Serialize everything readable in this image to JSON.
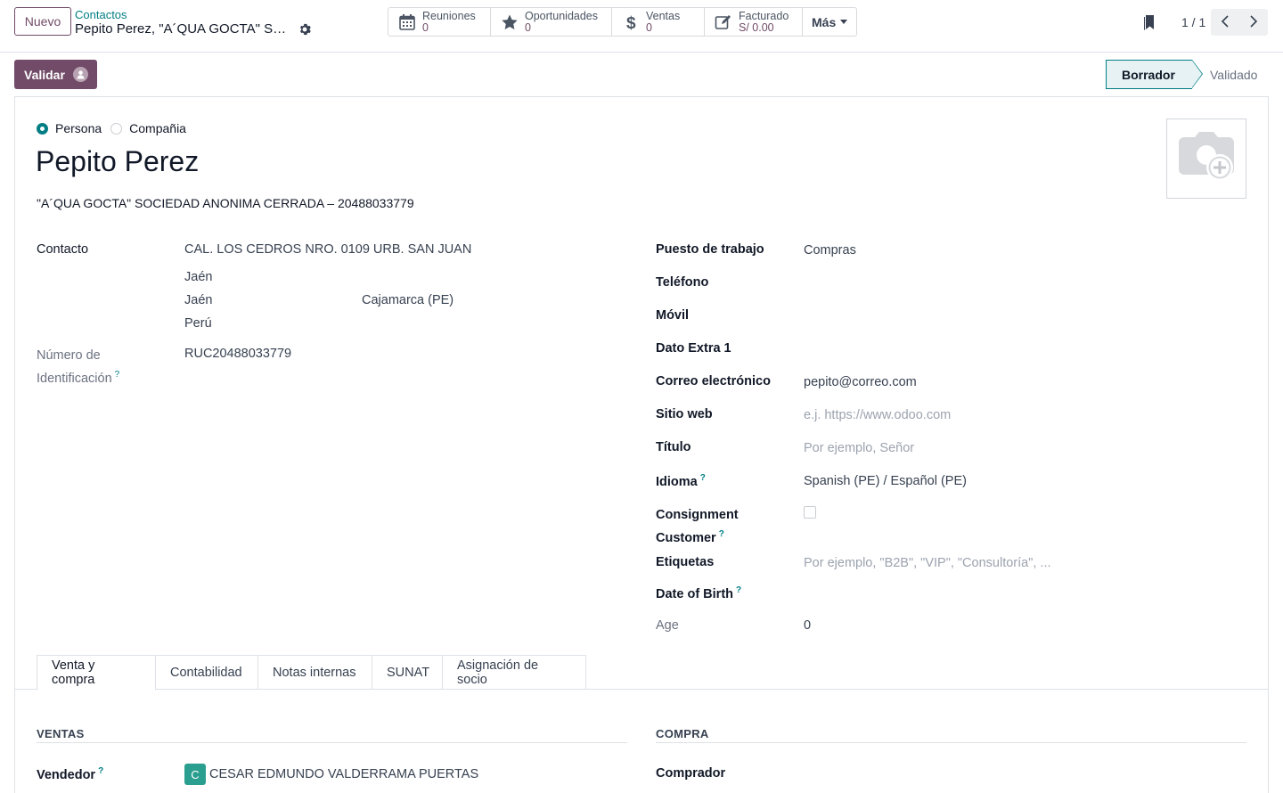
{
  "header": {
    "new_button": "Nuevo",
    "breadcrumb": "Contactos",
    "record_title": "Pepito Perez, \"A´QUA GOCTA\" SOCIEDAD ANONIMA CERRADA"
  },
  "smart_buttons": [
    {
      "label": "Reuniones",
      "value": "0",
      "icon": "calendar-icon"
    },
    {
      "label": "Oportunidades",
      "value": "0",
      "icon": "star-icon"
    },
    {
      "label": "Ventas",
      "value": "0",
      "icon": "dollar-icon"
    },
    {
      "label": "Facturado",
      "value": "S/ 0.00",
      "icon": "edit-invoice-icon"
    }
  ],
  "more_label": "Más",
  "pager": {
    "value": "1 / 1"
  },
  "actions": {
    "validate": "Validar"
  },
  "status": {
    "stages": [
      "Borrador",
      "Validado"
    ],
    "active": "Borrador"
  },
  "form": {
    "type_options": [
      "Persona",
      "Compañia"
    ],
    "selected_type": "Persona",
    "name": "Pepito Perez",
    "company_line": "\"A´QUA GOCTA\" SOCIEDAD ANONIMA CERRADA – 20488033779",
    "left": {
      "contact_label": "Contacto",
      "street": "CAL. LOS CEDROS NRO. 0109 URB. SAN JUAN",
      "district": "Jaén",
      "city": "Jaén",
      "state": "Cajamarca (PE)",
      "country": "Perú",
      "id_label": "Número de Identificación",
      "id_value": "RUC20488033779"
    },
    "right": {
      "job_label": "Puesto de trabajo",
      "job_value": "Compras",
      "phone_label": "Teléfono",
      "mobile_label": "Móvil",
      "extra_label": "Dato Extra 1",
      "email_label": "Correo electrónico",
      "email_value": "pepito@correo.com",
      "web_label": "Sitio web",
      "web_placeholder": "e.j. https://www.odoo.com",
      "title_label": "Título",
      "title_placeholder": "Por ejemplo, Señor",
      "lang_label": "Idioma",
      "lang_value": "Spanish (PE) / Español (PE)",
      "consign_label": "Consignment Customer",
      "tags_label": "Etiquetas",
      "tags_placeholder": "Por ejemplo, \"B2B\", \"VIP\", \"Consultoría\", ...",
      "dob_label": "Date of Birth",
      "age_label": "Age",
      "age_value": "0"
    }
  },
  "tabs": [
    "Venta y compra",
    "Contabilidad",
    "Notas internas",
    "SUNAT",
    "Asignación de socio"
  ],
  "active_tab": "Venta y compra",
  "sales": {
    "heading": "VENTAS",
    "vendor_label": "Vendedor",
    "vendor_initial": "C",
    "vendor_value": "CESAR EDMUNDO VALDERRAMA PUERTAS"
  },
  "purchase": {
    "heading": "COMPRA",
    "buyer_label": "Comprador"
  },
  "colors": {
    "primary": "#714b67",
    "accent": "#017e84"
  }
}
